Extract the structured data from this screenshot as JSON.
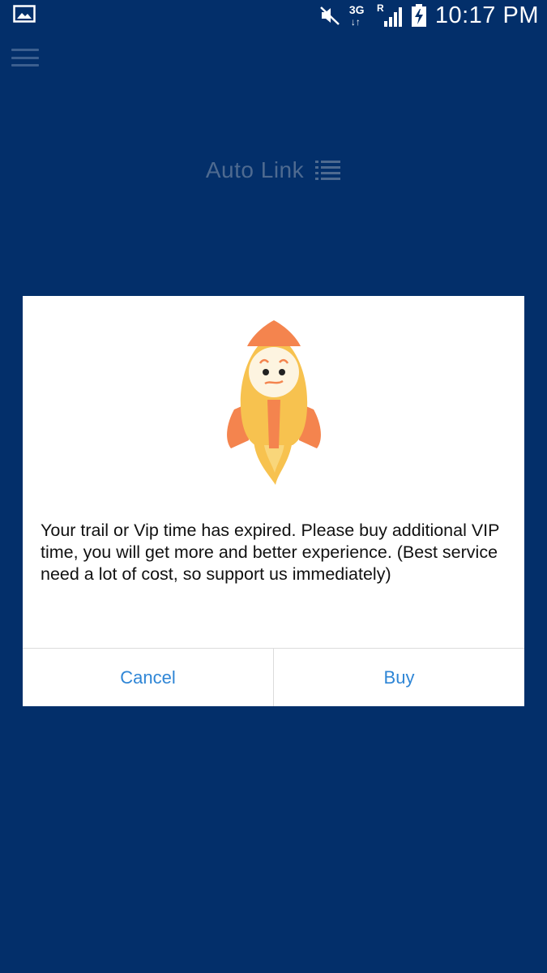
{
  "status_bar": {
    "time": "10:17 PM",
    "network_type": "3G",
    "network_arrows": "↓↑",
    "roaming": "R",
    "icons": [
      "gallery-icon",
      "mute-icon",
      "network-3g-icon",
      "signal-icon",
      "battery-charging-icon"
    ]
  },
  "app_bar": {
    "menu_icon": "hamburger-menu-icon",
    "title": "Auto Link",
    "title_icon": "list-icon"
  },
  "dialog": {
    "illustration": "rocket-icon",
    "message": "Your trail or Vip time has expired. Please buy additional VIP time, you will get more and better experience. (Best service need a lot of cost, so support us immediately)",
    "cancel_label": "Cancel",
    "buy_label": "Buy"
  },
  "colors": {
    "background": "#032f6a",
    "dialog_background": "#ffffff",
    "button_text": "#2f86d6",
    "title_text": "#4e6a90",
    "rocket_body": "#f7c24f",
    "rocket_accent": "#f4844e"
  }
}
